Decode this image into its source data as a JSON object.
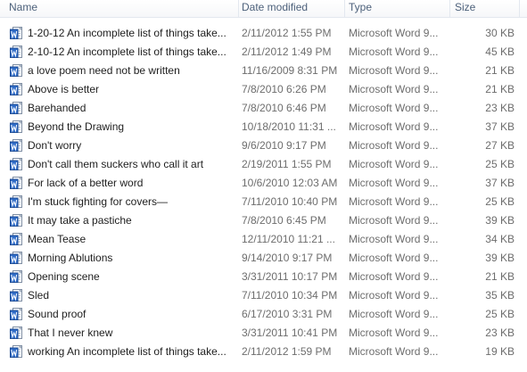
{
  "columns": {
    "name": "Name",
    "date": "Date modified",
    "type": "Type",
    "size": "Size"
  },
  "icon": "word-document-icon",
  "files": [
    {
      "name": "1-20-12 An incomplete list of things take...",
      "date": "2/11/2012 1:55 PM",
      "type": "Microsoft Word 9...",
      "size": "30 KB"
    },
    {
      "name": "2-10-12 An incomplete list of things take...",
      "date": "2/11/2012 1:49 PM",
      "type": "Microsoft Word 9...",
      "size": "45 KB"
    },
    {
      "name": "a love poem need not be written",
      "date": "11/16/2009 8:31 PM",
      "type": "Microsoft Word 9...",
      "size": "21 KB"
    },
    {
      "name": "Above is better",
      "date": "7/8/2010 6:26 PM",
      "type": "Microsoft Word 9...",
      "size": "21 KB"
    },
    {
      "name": "Barehanded",
      "date": "7/8/2010 6:46 PM",
      "type": "Microsoft Word 9...",
      "size": "23 KB"
    },
    {
      "name": "Beyond the Drawing",
      "date": "10/18/2010 11:31 ...",
      "type": "Microsoft Word 9...",
      "size": "37 KB"
    },
    {
      "name": "Don't worry",
      "date": "9/6/2010 9:17 PM",
      "type": "Microsoft Word 9...",
      "size": "27 KB"
    },
    {
      "name": "Don't call them suckers who call it art",
      "date": "2/19/2011 1:55 PM",
      "type": "Microsoft Word 9...",
      "size": "25 KB"
    },
    {
      "name": "For lack of a better word",
      "date": "10/6/2010 12:03 AM",
      "type": "Microsoft Word 9...",
      "size": "37 KB"
    },
    {
      "name": "I'm stuck fighting for covers—",
      "date": "7/11/2010 10:40 PM",
      "type": "Microsoft Word 9...",
      "size": "25 KB"
    },
    {
      "name": "It may take a pastiche",
      "date": "7/8/2010 6:45 PM",
      "type": "Microsoft Word 9...",
      "size": "39 KB"
    },
    {
      "name": "Mean Tease",
      "date": "12/11/2010 11:21 ...",
      "type": "Microsoft Word 9...",
      "size": "34 KB"
    },
    {
      "name": "Morning Ablutions",
      "date": "9/14/2010 9:17 PM",
      "type": "Microsoft Word 9...",
      "size": "39 KB"
    },
    {
      "name": "Opening scene",
      "date": "3/31/2011 10:17 PM",
      "type": "Microsoft Word 9...",
      "size": "21 KB"
    },
    {
      "name": "Sled",
      "date": "7/11/2010 10:34 PM",
      "type": "Microsoft Word 9...",
      "size": "35 KB"
    },
    {
      "name": "Sound proof",
      "date": "6/17/2010 3:31 PM",
      "type": "Microsoft Word 9...",
      "size": "25 KB"
    },
    {
      "name": "That I never knew",
      "date": "3/31/2011 10:41 PM",
      "type": "Microsoft Word 9...",
      "size": "23 KB"
    },
    {
      "name": "working An incomplete list of things take...",
      "date": "2/11/2012 1:59 PM",
      "type": "Microsoft Word 9...",
      "size": "19 KB"
    }
  ]
}
